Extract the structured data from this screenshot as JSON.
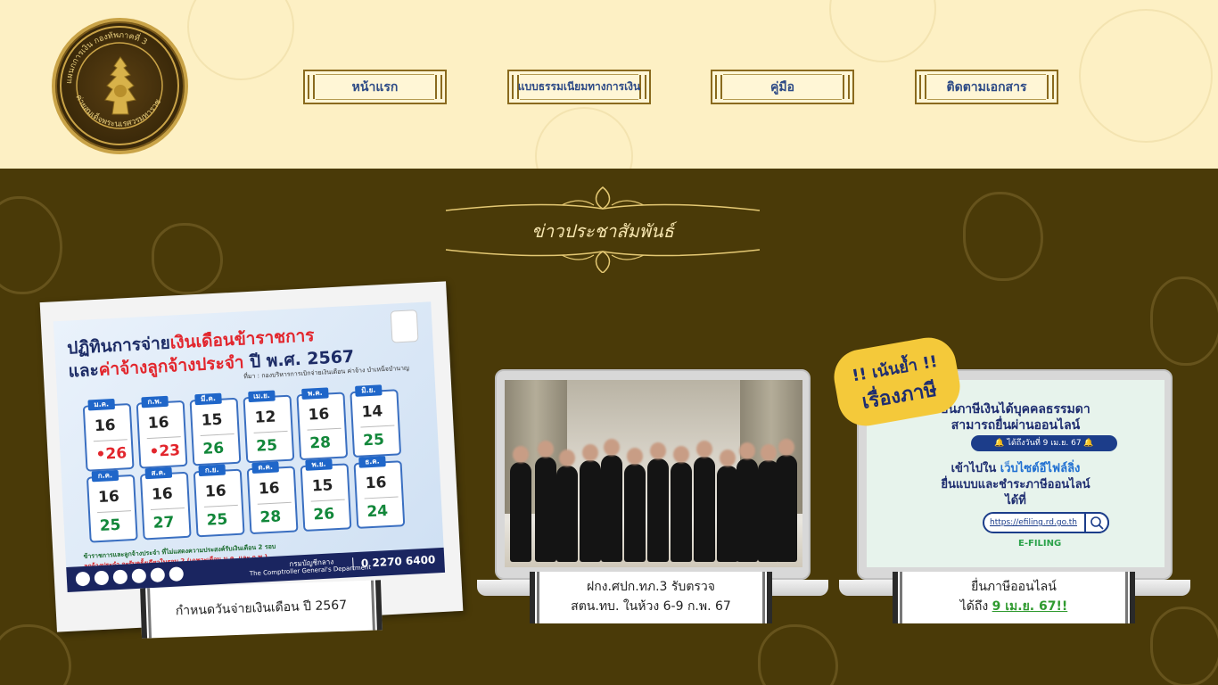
{
  "header": {
    "logo_ring_top": "แผนกการเงิน กองทัพภาคที่ 3",
    "logo_ring_bottom": "ค่ายสมเด็จพระนเรศวรมหาราช",
    "nav": [
      {
        "label": "หน้าแรก"
      },
      {
        "label": "แบบธรรมเนียมทางการเงิน"
      },
      {
        "label": "คู่มือ"
      },
      {
        "label": "ติดตามเอกสาร"
      }
    ],
    "colors": {
      "header_bg": "#fdf0c4",
      "nav_text": "#2d4a86",
      "nav_border": "#8a6a1e"
    }
  },
  "news": {
    "title": "ข่าวประชาสัมพันธ์",
    "bg_color": "#4a3a08",
    "cards": [
      {
        "caption": "กำหนดวันจ่ายเงินเดือน ปี 2567",
        "calendar": {
          "title_a": "ปฏิทินการจ่าย",
          "title_a_red": "เงินเดือนข้าราชการ",
          "title_b": "และ",
          "title_b_red": "ค่าจ้างลูกจ้างประจำ",
          "title_b_tail": " ปี พ.ศ. 2567",
          "subtitle": "ที่มา : กองบริหารการเบิกจ่ายเงินเดือน ค่าจ้าง บำเหน็จบำนาญ",
          "months": [
            {
              "name": "ม.ค.",
              "round1": "16",
              "round2": "•26",
              "red": true
            },
            {
              "name": "ก.พ.",
              "round1": "16",
              "round2": "•23",
              "red": true
            },
            {
              "name": "มี.ค.",
              "round1": "15",
              "round2": "26",
              "red": false
            },
            {
              "name": "เม.ย.",
              "round1": "12",
              "round2": "25",
              "red": false
            },
            {
              "name": "พ.ค.",
              "round1": "16",
              "round2": "28",
              "red": false
            },
            {
              "name": "มิ.ย.",
              "round1": "14",
              "round2": "25",
              "red": false
            },
            {
              "name": "ก.ค.",
              "round1": "16",
              "round2": "25",
              "red": false
            },
            {
              "name": "ส.ค.",
              "round1": "16",
              "round2": "27",
              "red": false
            },
            {
              "name": "ก.ย.",
              "round1": "16",
              "round2": "25",
              "red": false
            },
            {
              "name": "ต.ค.",
              "round1": "16",
              "round2": "28",
              "red": false
            },
            {
              "name": "พ.ย.",
              "round1": "15",
              "round2": "26",
              "red": false
            },
            {
              "name": "ธ.ค.",
              "round1": "16",
              "round2": "24",
              "red": false
            }
          ],
          "legend_1": "ข้าราชการและลูกจ้างประจำ ที่ไม่แสดงความประสงค์รับเงินเดือน 2 รอบ",
          "legend_2": "ลูกจ้างประจำ จะรับครั้งเดียวในรอบ 2 (เฉพาะเดือน ม.ค. และ ก.พ.)",
          "dept_th": "กรมบัญชีกลาง",
          "dept_en": "The Comptroller General's Department",
          "phone": "0 2270 6400"
        }
      },
      {
        "caption_line1": "ฝกง.ศปก.ทภ.3 รับตรวจ",
        "caption_line2": "สตน.ทบ. ในห้วง 6-9 ก.พ. 67"
      },
      {
        "caption_line1": "ยื่นภาษีออนไลน์",
        "caption_line2_prefix": "ได้ถึง ",
        "caption_line2_link": "9 เม.ย. 67!!",
        "stamp_line1": "!! เน้นย้ำ !!",
        "stamp_line2": "เรื่องภาษี",
        "screen": {
          "line1": "ยื่นภาษีเงินได้บุคคลธรรมดา",
          "line2": "สามารถยื่นผ่านออนไลน์",
          "pill": "🔔 ได้ถึงวันที่ 9 เม.ย. 67 🔔",
          "line3_prefix": "เข้าไปใน ",
          "line3_highlight": "เว็บไซต์อีไฟล์ลิ่ง",
          "line4": "ยื่นแบบและชำระภาษีออนไลน์",
          "line5": "ได้ที่",
          "url": "https://efiling.rd.go.th",
          "brand": "E-FILING"
        }
      }
    ]
  }
}
